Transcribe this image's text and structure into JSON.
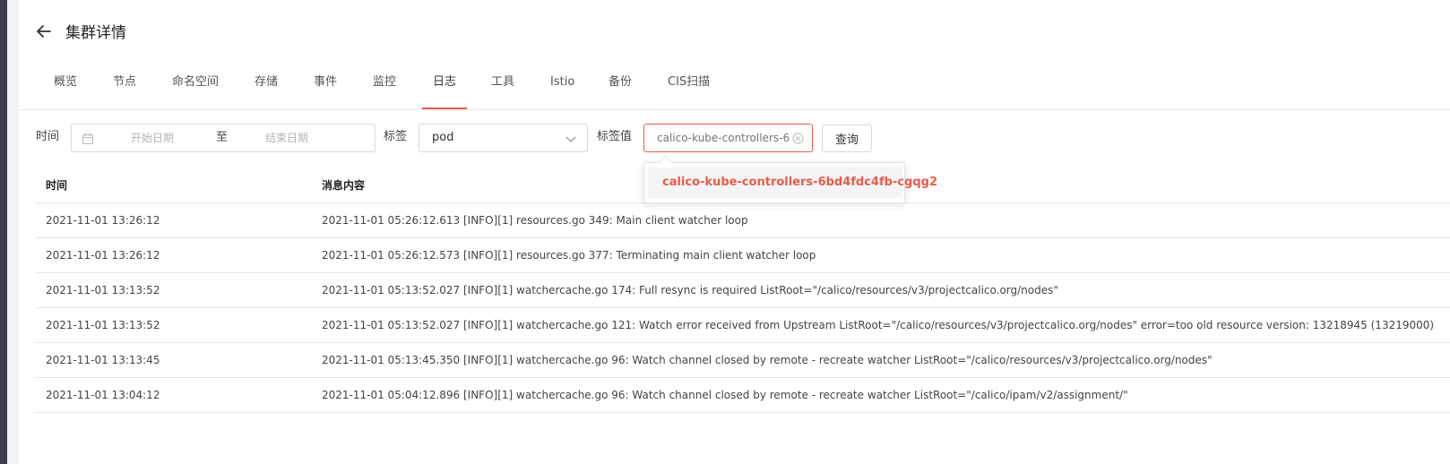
{
  "page": {
    "title": "集群详情"
  },
  "tabs": [
    {
      "label": "概览"
    },
    {
      "label": "节点"
    },
    {
      "label": "命名空间"
    },
    {
      "label": "存储"
    },
    {
      "label": "事件"
    },
    {
      "label": "监控"
    },
    {
      "label": "日志",
      "active": true
    },
    {
      "label": "工具"
    },
    {
      "label": "Istio"
    },
    {
      "label": "备份"
    },
    {
      "label": "CIS扫描"
    }
  ],
  "filters": {
    "time_label": "时间",
    "start_placeholder": "开始日期",
    "range_separator": "至",
    "end_placeholder": "结束日期",
    "tag_label": "标签",
    "tag_value": "pod",
    "tag_value_label": "标签值",
    "tag_value_input": "calico-kube-controllers-6bd4fdc4fb-cgqg2",
    "query_button": "查询"
  },
  "dropdown": {
    "options": [
      "calico-kube-controllers-6bd4fdc4fb-cgqg2"
    ]
  },
  "table": {
    "columns": [
      "时间",
      "消息内容"
    ],
    "rows": [
      {
        "time": "2021-11-01 13:26:12",
        "message": "2021-11-01 05:26:12.613 [INFO][1] resources.go 349: Main client watcher loop"
      },
      {
        "time": "2021-11-01 13:26:12",
        "message": "2021-11-01 05:26:12.573 [INFO][1] resources.go 377: Terminating main client watcher loop"
      },
      {
        "time": "2021-11-01 13:13:52",
        "message": "2021-11-01 05:13:52.027 [INFO][1] watchercache.go 174: Full resync is required ListRoot=\"/calico/resources/v3/projectcalico.org/nodes\""
      },
      {
        "time": "2021-11-01 13:13:52",
        "message": "2021-11-01 05:13:52.027 [INFO][1] watchercache.go 121: Watch error received from Upstream ListRoot=\"/calico/resources/v3/projectcalico.org/nodes\" error=too old resource version: 13218945 (13219000)"
      },
      {
        "time": "2021-11-01 13:13:45",
        "message": "2021-11-01 05:13:45.350 [INFO][1] watchercache.go 96: Watch channel closed by remote - recreate watcher ListRoot=\"/calico/resources/v3/projectcalico.org/nodes\""
      },
      {
        "time": "2021-11-01 13:04:12",
        "message": "2021-11-01 05:04:12.896 [INFO][1] watchercache.go 96: Watch channel closed by remote - recreate watcher ListRoot=\"/calico/ipam/v2/assignment/\""
      }
    ]
  },
  "colors": {
    "accent": "#e85c4a",
    "sidebar": "#3a3f47"
  }
}
